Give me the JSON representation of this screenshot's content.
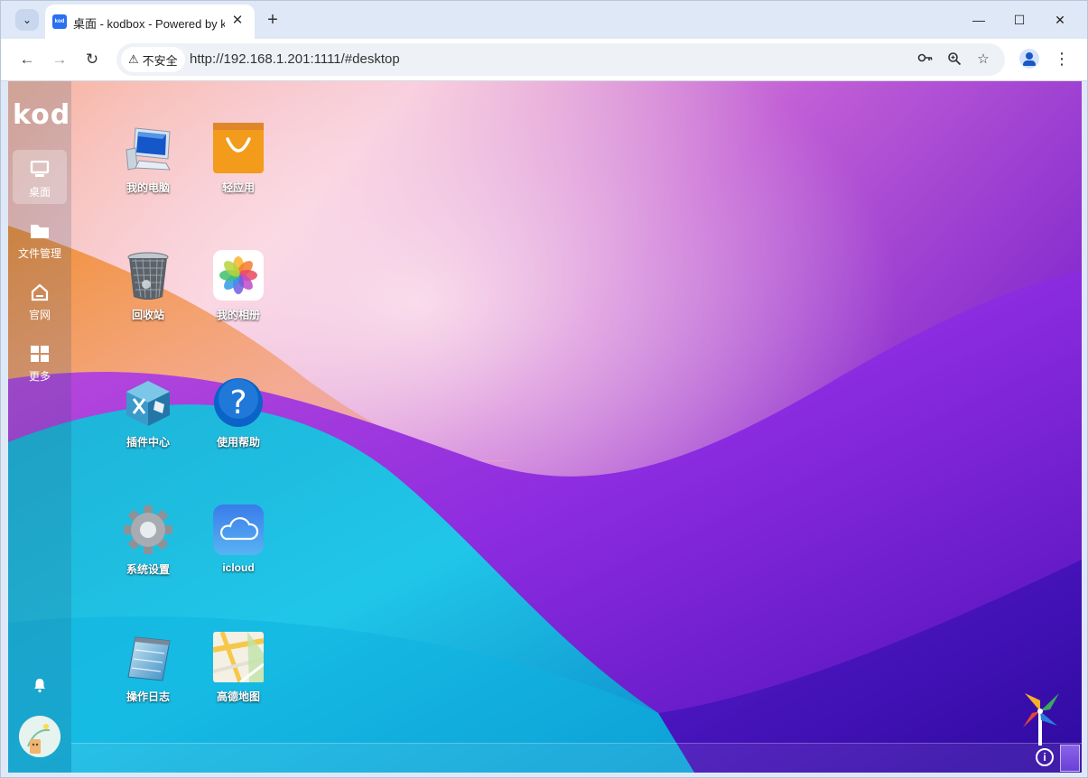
{
  "browser": {
    "tab_title": "桌面 - kodbox - Powered by kodbox",
    "favicon_text": "kod",
    "security_label": "不安全",
    "url": "http://192.168.1.201:1111/#desktop",
    "icons": {
      "tab_menu": "chevron-down-icon",
      "close_tab": "close-icon",
      "new_tab": "plus-icon",
      "minimize": "minimize-icon",
      "maximize": "maximize-icon",
      "close_window": "close-icon",
      "back": "arrow-left-icon",
      "forward": "arrow-right-icon",
      "reload": "reload-icon",
      "password": "key-icon",
      "zoom": "zoom-icon",
      "bookmark": "star-icon",
      "profile": "profile-icon",
      "menu": "kebab-menu-icon"
    }
  },
  "sidebar": {
    "logo": "kod",
    "items": [
      {
        "label": "桌面",
        "icon": "monitor-icon",
        "active": true
      },
      {
        "label": "文件管理",
        "icon": "folder-icon",
        "active": false
      },
      {
        "label": "官网",
        "icon": "home-icon",
        "active": false
      },
      {
        "label": "更多",
        "icon": "grid-icon",
        "active": false
      }
    ]
  },
  "desktop": {
    "items": [
      {
        "label": "我的电脑",
        "icon": "computer-icon"
      },
      {
        "label": "轻应用",
        "icon": "shopping-bag-icon"
      },
      {
        "label": "回收站",
        "icon": "recycle-bin-icon"
      },
      {
        "label": "我的相册",
        "icon": "photos-icon"
      },
      {
        "label": "插件中心",
        "icon": "plugin-icon"
      },
      {
        "label": "使用帮助",
        "icon": "help-icon"
      },
      {
        "label": "系统设置",
        "icon": "settings-gear-icon"
      },
      {
        "label": "icloud",
        "icon": "cloud-icon"
      },
      {
        "label": "操作日志",
        "icon": "notepad-icon"
      },
      {
        "label": "高德地图",
        "icon": "map-icon"
      }
    ]
  },
  "taskbar": {
    "info_symbol": "i"
  }
}
